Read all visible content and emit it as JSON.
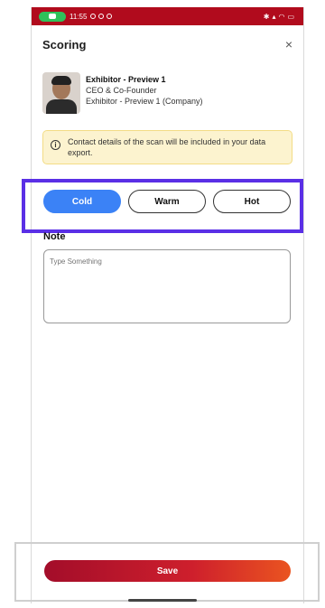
{
  "status_bar": {
    "time": "11:55",
    "accent": "#b10b1d",
    "pill_color": "#2fc15a"
  },
  "header": {
    "title": "Scoring",
    "close_symbol": "×"
  },
  "profile": {
    "name": "Exhibitor - Preview 1",
    "role": "CEO & Co-Founder",
    "company": "Exhibitor - Preview 1 (Company)"
  },
  "notice": {
    "icon": "info-icon",
    "text": "Contact details of the scan will be included in your data export."
  },
  "scoring": {
    "selected": "Cold",
    "options": [
      {
        "label": "Cold"
      },
      {
        "label": "Warm"
      },
      {
        "label": "Hot"
      }
    ],
    "active_color": "#3b82f6",
    "highlight_color": "#5a2fe6"
  },
  "note": {
    "label": "Note",
    "placeholder": "Type Something",
    "value": ""
  },
  "footer": {
    "save_label": "Save"
  }
}
